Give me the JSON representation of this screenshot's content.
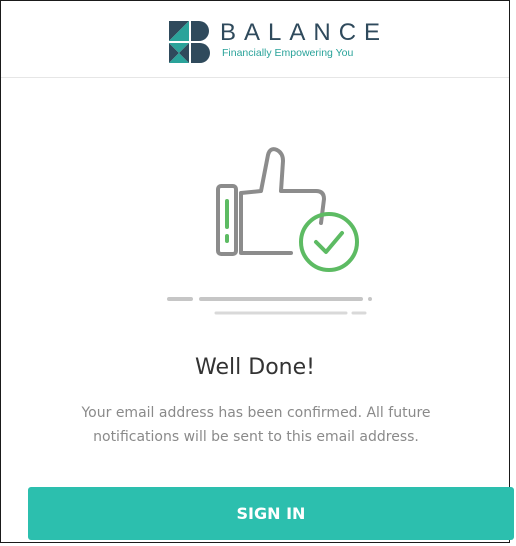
{
  "brand": {
    "name": "BALANCE",
    "tagline": "Financially Empowering You",
    "colors": {
      "dark": "#2f4a5c",
      "teal": "#2aa39a",
      "green": "#5dbb63",
      "button": "#2cbfae"
    }
  },
  "illustration": {
    "icon": "thumbs-up-check-icon"
  },
  "main": {
    "title": "Well Done!",
    "message": "Your email address has been confirmed. All future notifications will be sent to this email address."
  },
  "actions": {
    "signin_label": "SIGN IN"
  }
}
